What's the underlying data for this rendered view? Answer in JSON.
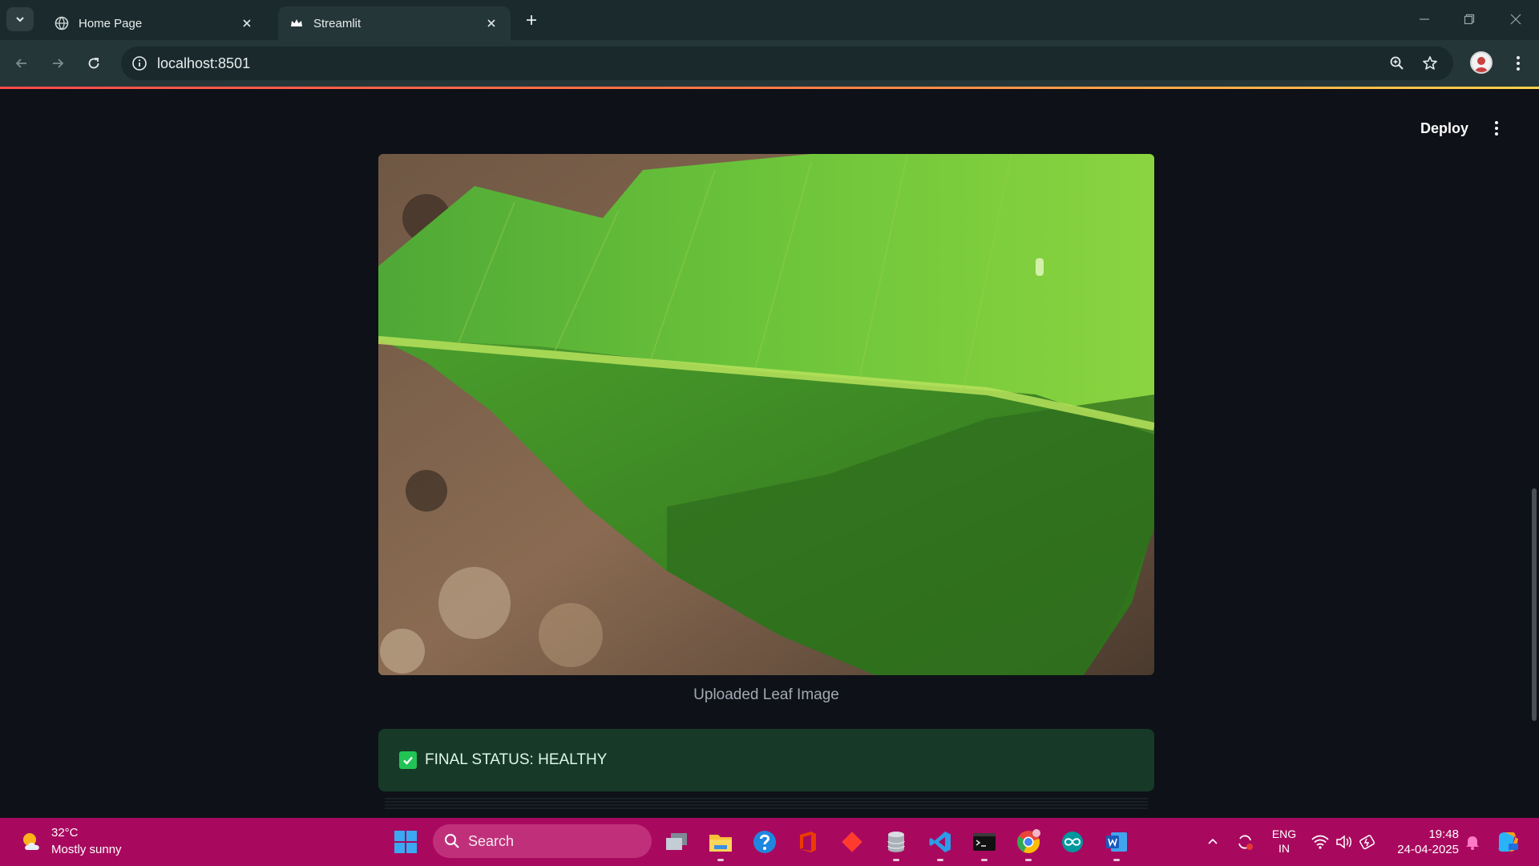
{
  "browser": {
    "tabs": [
      {
        "title": "Home Page",
        "active": false,
        "icon": "globe-icon"
      },
      {
        "title": "Streamlit",
        "active": true,
        "icon": "streamlit-crown-icon"
      }
    ],
    "url": "localhost:8501"
  },
  "app": {
    "deploy_label": "Deploy",
    "image_caption": "Uploaded Leaf Image",
    "status_text": "FINAL STATUS: HEALTHY",
    "status_color": "#21c354"
  },
  "taskbar": {
    "weather": {
      "temp": "32°C",
      "desc": "Mostly sunny"
    },
    "search_label": "Search",
    "apps": [
      "task-view-icon",
      "file-explorer-icon",
      "help-icon",
      "office-icon",
      "git-icon",
      "database-icon",
      "vscode-icon",
      "terminal-icon",
      "chrome-icon",
      "arduino-icon",
      "word-icon"
    ],
    "lang_top": "ENG",
    "lang_bottom": "IN",
    "time": "19:48",
    "date": "24-04-2025"
  },
  "colors": {
    "page_bg": "#0e1117",
    "taskbar_bg": "#a8095e",
    "status_bg": "#173928"
  }
}
